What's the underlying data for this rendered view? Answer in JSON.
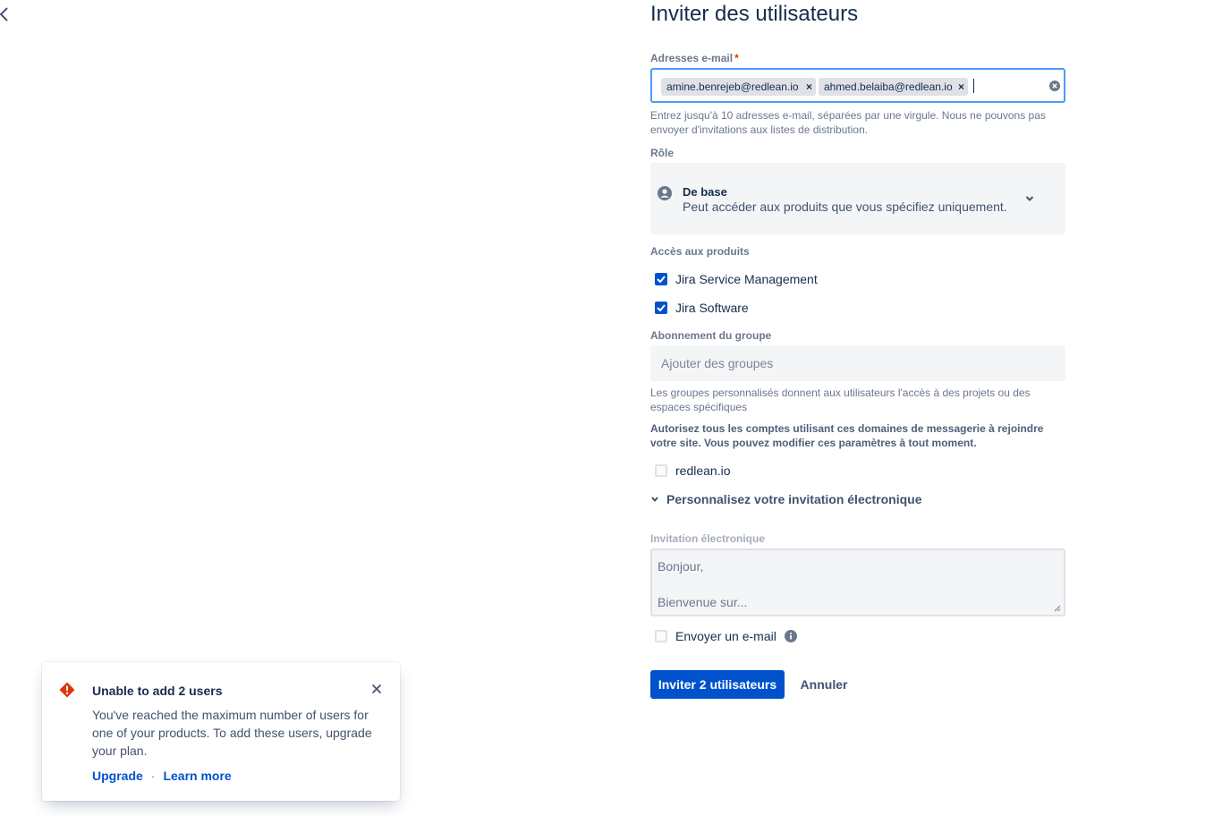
{
  "header": {
    "title": "Inviter des utilisateurs"
  },
  "email": {
    "label": "Adresses e-mail",
    "required_marker": "*",
    "chips": [
      "amine.benrejeb@redlean.io",
      "ahmed.belaiba@redlean.io"
    ],
    "chip_remove": "×",
    "helper": "Entrez jusqu'à 10 adresses e-mail, séparées par une virgule. Nous ne pouvons pas envoyer d'invitations aux listes de distribution."
  },
  "role": {
    "label": "Rôle",
    "selected_name": "De base",
    "selected_description": "Peut accéder aux produits que vous spécifiez uniquement."
  },
  "products": {
    "label": "Accès aux produits",
    "items": [
      {
        "label": "Jira Service Management",
        "checked": true
      },
      {
        "label": "Jira Software",
        "checked": true
      }
    ]
  },
  "groups": {
    "label": "Abonnement du groupe",
    "placeholder": "Ajouter des groupes",
    "helper": "Les groupes personnalisés donnent aux utilisateurs l'accès à des projets ou des espaces spécifiques"
  },
  "domains": {
    "helper": "Autorisez tous les comptes utilisant ces domaines de messagerie à rejoindre votre site. Vous pouvez modifier ces paramètres à tout moment.",
    "items": [
      {
        "label": "redlean.io",
        "checked": false
      }
    ]
  },
  "customize": {
    "label": "Personnalisez votre invitation électronique"
  },
  "invitation": {
    "label": "Invitation électronique",
    "line1": "Bonjour,",
    "line2": "Bienvenue sur..."
  },
  "send_email": {
    "label": "Envoyer un e-mail",
    "checked": false
  },
  "actions": {
    "submit": "Inviter 2 utilisateurs",
    "cancel": "Annuler"
  },
  "flag": {
    "title": "Unable to add 2 users",
    "body": "You've reached the maximum number of users for one of your products. To add these users, upgrade your plan.",
    "upgrade": "Upgrade",
    "separator": "·",
    "learn_more": "Learn more"
  },
  "colors": {
    "primary": "#0052cc",
    "focus_border": "#4c9aff",
    "error": "#de350b",
    "text": "#172b4d"
  }
}
